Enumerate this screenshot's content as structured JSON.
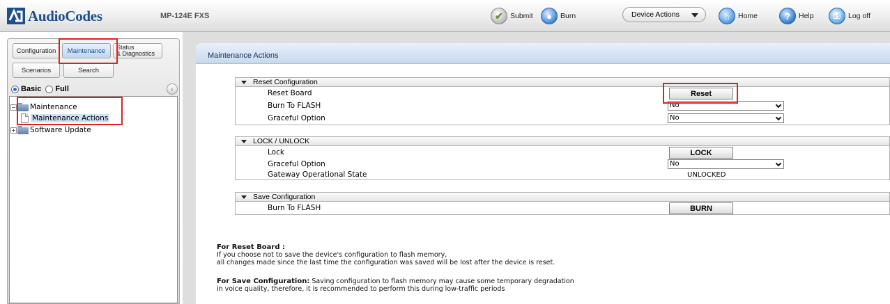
{
  "app": {
    "brand": "AudioCodes",
    "device_name": "MP-124E FXS"
  },
  "toolbar": {
    "submit_label": "Submit",
    "burn_label": "Burn",
    "device_actions_label": "Device Actions",
    "home_label": "Home",
    "help_label": "Help",
    "logoff_label": "Log off"
  },
  "nav": {
    "tabs": {
      "configuration": "Configuration",
      "maintenance": "Maintenance",
      "status_line1": "Status",
      "status_line2": "& Diagnostics",
      "scenarios": "Scenarios",
      "search": "Search"
    },
    "mode": {
      "basic": "Basic",
      "full": "Full",
      "selected": "Basic"
    },
    "tree": {
      "maintenance": "Maintenance",
      "maintenance_actions": "Maintenance Actions",
      "software_update": "Software Update"
    }
  },
  "page": {
    "title": "Maintenance Actions"
  },
  "groups": {
    "reset": {
      "title": "Reset Configuration",
      "reset_board_label": "Reset Board",
      "reset_button": "Reset",
      "burn_to_flash_label": "Burn To FLASH",
      "burn_to_flash_value": "No",
      "graceful_label": "Graceful Option",
      "graceful_value": "No"
    },
    "lock": {
      "title": "LOCK / UNLOCK",
      "lock_label": "Lock",
      "lock_button": "LOCK",
      "graceful_label": "Graceful Option",
      "graceful_value": "No",
      "state_label": "Gateway Operational State",
      "state_value": "UNLOCKED"
    },
    "save": {
      "title": "Save Configuration",
      "burn_label": "Burn To FLASH",
      "burn_button": "BURN"
    }
  },
  "notes": {
    "reset_heading": "For Reset Board :",
    "reset_line1": "If you choose not to save the device's configuration to flash memory,",
    "reset_line2": "all changes made since the last time the configuration was saved will be lost after the device is reset.",
    "save_heading": "For Save Configuration:",
    "save_line1": " Saving configuration to flash memory may cause some temporary degradation",
    "save_line2": "in voice quality, therefore, it is recommended to perform this during low-traffic periods"
  },
  "colors": {
    "brand_blue": "#1f4f8b",
    "highlight_red": "#e02020",
    "header_blue": "#c8d9ee"
  }
}
